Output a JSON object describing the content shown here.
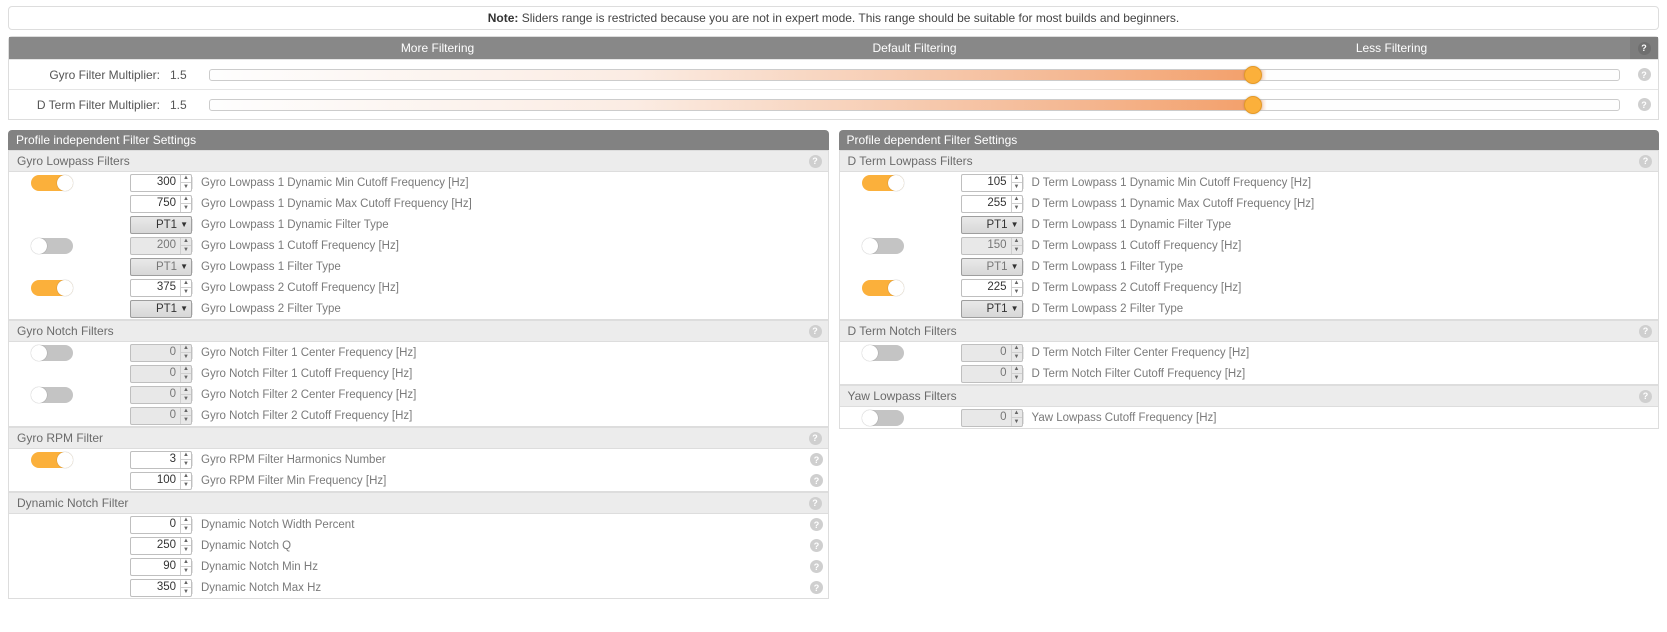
{
  "note": {
    "bold": "Note:",
    "text": " Sliders range is restricted because you are not in expert mode. This range should be suitable for most builds and beginners."
  },
  "slider_columns": {
    "more": "More Filtering",
    "default": "Default Filtering",
    "less": "Less Filtering"
  },
  "sliders": {
    "gyro": {
      "label": "Gyro Filter Multiplier:",
      "value": "1.5",
      "pos_pct": 74
    },
    "dterm": {
      "label": "D Term Filter Multiplier:",
      "value": "1.5",
      "pos_pct": 74
    }
  },
  "left_panel_title": "Profile independent Filter Settings",
  "right_panel_title": "Profile dependent Filter Settings",
  "filter_types": {
    "pt1": "PT1"
  },
  "sections": {
    "gyro_lowpass": {
      "title": "Gyro Lowpass Filters",
      "rows": [
        {
          "toggle": "on",
          "kind": "num",
          "value": "300",
          "label": "Gyro Lowpass 1 Dynamic Min Cutoff Frequency [Hz]"
        },
        {
          "toggle": null,
          "kind": "num",
          "value": "750",
          "label": "Gyro Lowpass 1 Dynamic Max Cutoff Frequency [Hz]"
        },
        {
          "toggle": null,
          "kind": "sel",
          "value": "PT1",
          "label": "Gyro Lowpass 1 Dynamic Filter Type"
        },
        {
          "toggle": "off",
          "kind": "num",
          "value": "200",
          "disabled": true,
          "label": "Gyro Lowpass 1 Cutoff Frequency [Hz]"
        },
        {
          "toggle": null,
          "kind": "sel",
          "value": "PT1",
          "disabled": true,
          "label": "Gyro Lowpass 1 Filter Type"
        },
        {
          "toggle": "on",
          "kind": "num",
          "value": "375",
          "label": "Gyro Lowpass 2 Cutoff Frequency [Hz]"
        },
        {
          "toggle": null,
          "kind": "sel",
          "value": "PT1",
          "label": "Gyro Lowpass 2 Filter Type"
        }
      ]
    },
    "gyro_notch": {
      "title": "Gyro Notch Filters",
      "rows": [
        {
          "toggle": "off",
          "kind": "num",
          "value": "0",
          "disabled": true,
          "label": "Gyro Notch Filter 1 Center Frequency [Hz]"
        },
        {
          "toggle": null,
          "kind": "num",
          "value": "0",
          "disabled": true,
          "label": "Gyro Notch Filter 1 Cutoff Frequency [Hz]"
        },
        {
          "toggle": "off",
          "kind": "num",
          "value": "0",
          "disabled": true,
          "label": "Gyro Notch Filter 2 Center Frequency [Hz]"
        },
        {
          "toggle": null,
          "kind": "num",
          "value": "0",
          "disabled": true,
          "label": "Gyro Notch Filter 2 Cutoff Frequency [Hz]"
        }
      ]
    },
    "gyro_rpm": {
      "title": "Gyro RPM Filter",
      "rows": [
        {
          "toggle": "on",
          "kind": "num",
          "value": "3",
          "label": "Gyro RPM Filter Harmonics Number",
          "help": true
        },
        {
          "toggle": null,
          "kind": "num",
          "value": "100",
          "label": "Gyro RPM Filter Min Frequency [Hz]",
          "help": true
        }
      ]
    },
    "dyn_notch": {
      "title": "Dynamic Notch Filter",
      "rows": [
        {
          "toggle": null,
          "kind": "num",
          "value": "0",
          "label": "Dynamic Notch Width Percent",
          "help": true
        },
        {
          "toggle": null,
          "kind": "num",
          "value": "250",
          "label": "Dynamic Notch Q",
          "help": true
        },
        {
          "toggle": null,
          "kind": "num",
          "value": "90",
          "label": "Dynamic Notch Min Hz",
          "help": true
        },
        {
          "toggle": null,
          "kind": "num",
          "value": "350",
          "label": "Dynamic Notch Max Hz",
          "help": true
        }
      ]
    },
    "dterm_lowpass": {
      "title": "D Term Lowpass Filters",
      "rows": [
        {
          "toggle": "on",
          "kind": "num",
          "value": "105",
          "label": "D Term Lowpass 1 Dynamic Min Cutoff Frequency [Hz]"
        },
        {
          "toggle": null,
          "kind": "num",
          "value": "255",
          "label": "D Term Lowpass 1 Dynamic Max Cutoff Frequency [Hz]"
        },
        {
          "toggle": null,
          "kind": "sel",
          "value": "PT1",
          "label": "D Term Lowpass 1 Dynamic Filter Type"
        },
        {
          "toggle": "off",
          "kind": "num",
          "value": "150",
          "disabled": true,
          "label": "D Term Lowpass 1 Cutoff Frequency [Hz]"
        },
        {
          "toggle": null,
          "kind": "sel",
          "value": "PT1",
          "disabled": true,
          "label": "D Term Lowpass 1 Filter Type"
        },
        {
          "toggle": "on",
          "kind": "num",
          "value": "225",
          "label": "D Term Lowpass 2 Cutoff Frequency [Hz]"
        },
        {
          "toggle": null,
          "kind": "sel",
          "value": "PT1",
          "label": "D Term Lowpass 2 Filter Type"
        }
      ]
    },
    "dterm_notch": {
      "title": "D Term Notch Filters",
      "rows": [
        {
          "toggle": "off",
          "kind": "num",
          "value": "0",
          "disabled": true,
          "label": "D Term Notch Filter Center Frequency [Hz]"
        },
        {
          "toggle": null,
          "kind": "num",
          "value": "0",
          "disabled": true,
          "label": "D Term Notch Filter Cutoff Frequency [Hz]"
        }
      ]
    },
    "yaw_lowpass": {
      "title": "Yaw Lowpass Filters",
      "rows": [
        {
          "toggle": "off",
          "kind": "num",
          "value": "0",
          "disabled": true,
          "label": "Yaw Lowpass Cutoff Frequency [Hz]"
        }
      ]
    }
  }
}
